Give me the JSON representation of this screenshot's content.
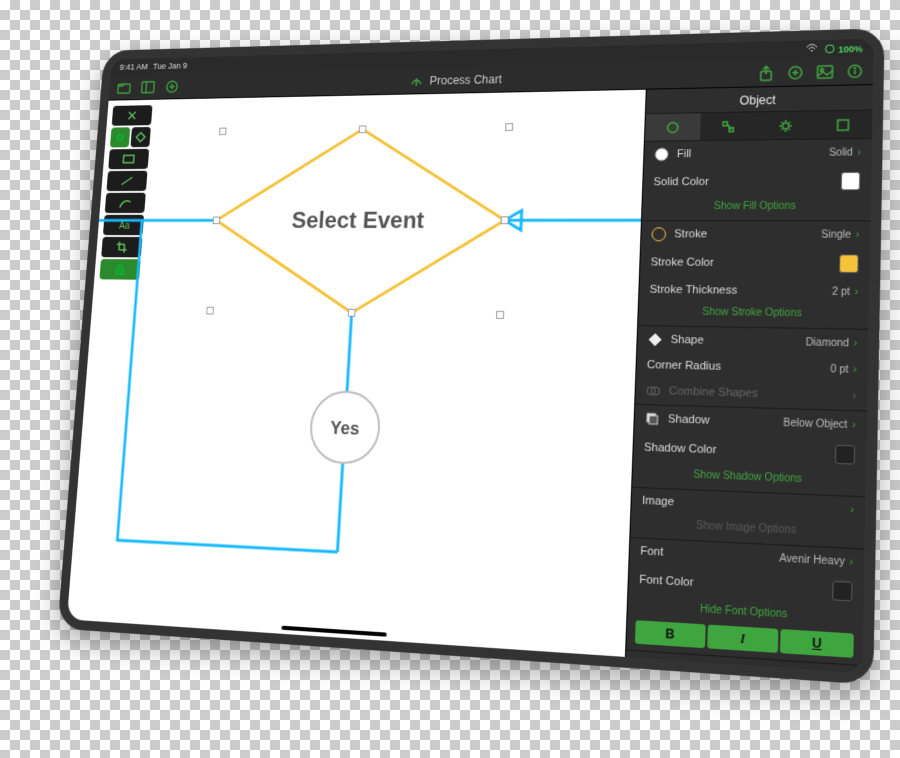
{
  "statusbar": {
    "time": "9:41 AM",
    "date": "Tue Jan 9",
    "battery": "100%"
  },
  "toolbar": {
    "title": "Process Chart"
  },
  "canvas": {
    "decision_label": "Select Event",
    "yes_label": "Yes"
  },
  "inspector": {
    "title": "Object",
    "fill": {
      "label": "Fill",
      "mode": "Solid",
      "color_label": "Solid Color",
      "color": "#ffffff",
      "options": "Show Fill Options"
    },
    "stroke": {
      "label": "Stroke",
      "mode": "Single",
      "color_label": "Stroke Color",
      "color": "#f5c23a",
      "thickness_label": "Stroke Thickness",
      "thickness": "2 pt",
      "options": "Show Stroke Options"
    },
    "shape": {
      "label": "Shape",
      "value": "Diamond",
      "radius_label": "Corner Radius",
      "radius": "0 pt",
      "combine": "Combine Shapes"
    },
    "shadow": {
      "label": "Shadow",
      "mode": "Below Object",
      "color_label": "Shadow Color",
      "options": "Show Shadow Options"
    },
    "image": {
      "label": "Image",
      "options": "Show Image Options"
    },
    "font": {
      "label": "Font",
      "value": "Avenir Heavy",
      "color_label": "Font Color",
      "options": "Hide Font Options",
      "bold": "B",
      "italic": "I",
      "underline": "U"
    }
  }
}
